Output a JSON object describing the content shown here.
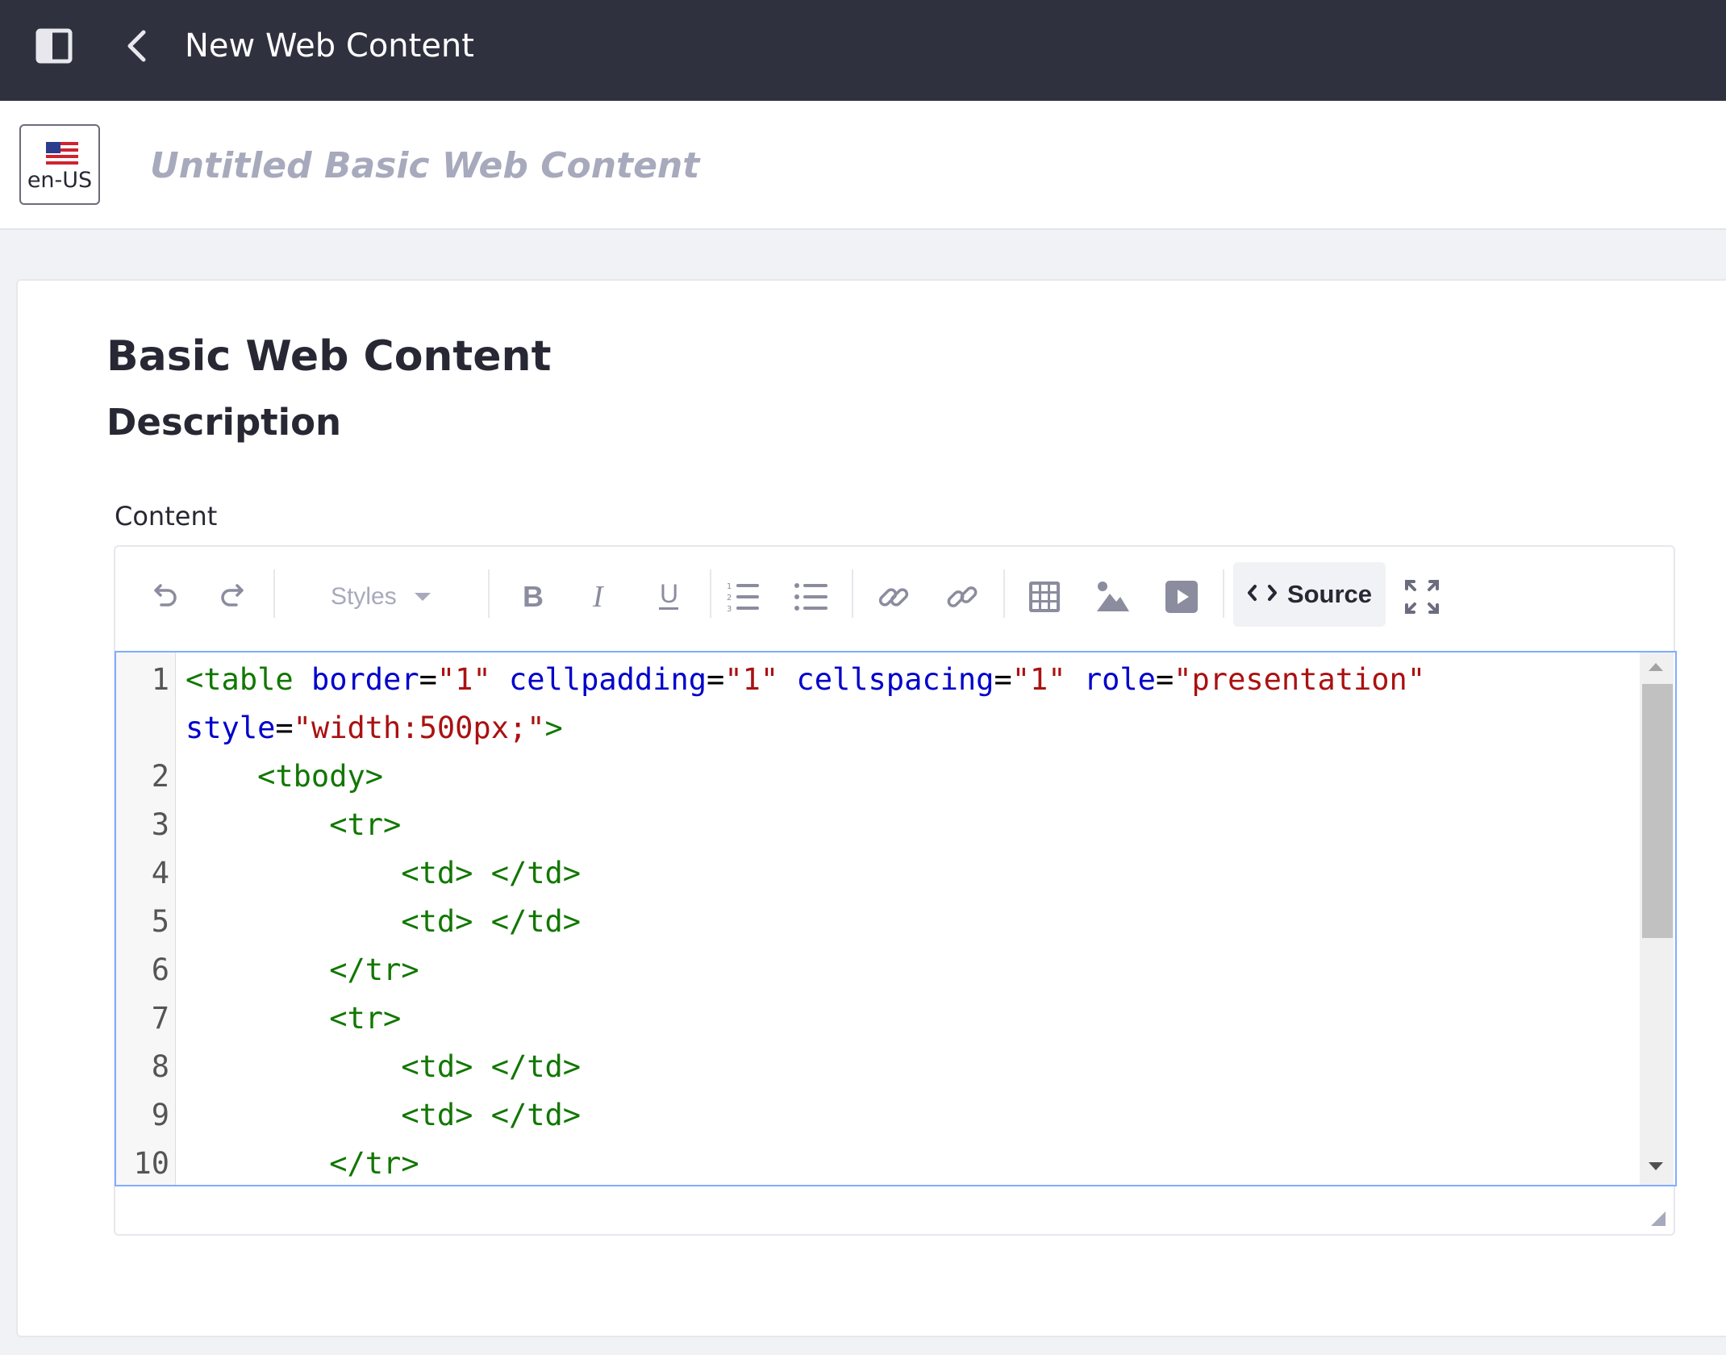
{
  "header": {
    "title": "New Web Content",
    "sidebar_toggle_icon": "product-menu-icon",
    "back_icon": "chevron-left-icon"
  },
  "subheader": {
    "locale": "en-US",
    "locale_icon": "us-flag-icon",
    "title_placeholder": "Untitled Basic Web Content"
  },
  "form": {
    "structure_title": "Basic Web Content",
    "section_title": "Description",
    "field_label": "Content"
  },
  "toolbar": {
    "styles_label": "Styles",
    "source_label": "Source"
  },
  "code": {
    "lines": [
      {
        "num": "1",
        "tokens": [
          [
            "tag",
            "<table"
          ],
          [
            "plain",
            " "
          ],
          [
            "attr",
            "border"
          ],
          [
            "plain",
            "="
          ],
          [
            "str",
            "\"1\""
          ],
          [
            "plain",
            " "
          ],
          [
            "attr",
            "cellpadding"
          ],
          [
            "plain",
            "="
          ],
          [
            "str",
            "\"1\""
          ],
          [
            "plain",
            " "
          ],
          [
            "attr",
            "cellspacing"
          ],
          [
            "plain",
            "="
          ],
          [
            "str",
            "\"1\""
          ],
          [
            "plain",
            " "
          ],
          [
            "attr",
            "role"
          ],
          [
            "plain",
            "="
          ],
          [
            "str",
            "\"presentation\""
          ]
        ]
      },
      {
        "num": "",
        "tokens": [
          [
            "attr",
            "style"
          ],
          [
            "plain",
            "="
          ],
          [
            "str",
            "\"width:500px;\""
          ],
          [
            "tag",
            ">"
          ]
        ]
      },
      {
        "num": "2",
        "tokens": [
          [
            "plain",
            "    "
          ],
          [
            "tag",
            "<tbody>"
          ]
        ]
      },
      {
        "num": "3",
        "tokens": [
          [
            "plain",
            "        "
          ],
          [
            "tag",
            "<tr>"
          ]
        ]
      },
      {
        "num": "4",
        "tokens": [
          [
            "plain",
            "            "
          ],
          [
            "tag",
            "<td>"
          ],
          [
            "plain",
            " "
          ],
          [
            "tag",
            "</td>"
          ]
        ]
      },
      {
        "num": "5",
        "tokens": [
          [
            "plain",
            "            "
          ],
          [
            "tag",
            "<td>"
          ],
          [
            "plain",
            " "
          ],
          [
            "tag",
            "</td>"
          ]
        ]
      },
      {
        "num": "6",
        "tokens": [
          [
            "plain",
            "        "
          ],
          [
            "tag",
            "</tr>"
          ]
        ]
      },
      {
        "num": "7",
        "tokens": [
          [
            "plain",
            "        "
          ],
          [
            "tag",
            "<tr>"
          ]
        ]
      },
      {
        "num": "8",
        "tokens": [
          [
            "plain",
            "            "
          ],
          [
            "tag",
            "<td>"
          ],
          [
            "plain",
            " "
          ],
          [
            "tag",
            "</td>"
          ]
        ]
      },
      {
        "num": "9",
        "tokens": [
          [
            "plain",
            "            "
          ],
          [
            "tag",
            "<td>"
          ],
          [
            "plain",
            " "
          ],
          [
            "tag",
            "</td>"
          ]
        ]
      },
      {
        "num": "10",
        "tokens": [
          [
            "plain",
            "        "
          ],
          [
            "tag",
            "</tr>"
          ]
        ]
      }
    ]
  },
  "colors": {
    "topbar": "#30313f",
    "tag": "#117700",
    "attribute": "#0000cc",
    "string": "#aa1111",
    "focus_border": "#80acff"
  }
}
